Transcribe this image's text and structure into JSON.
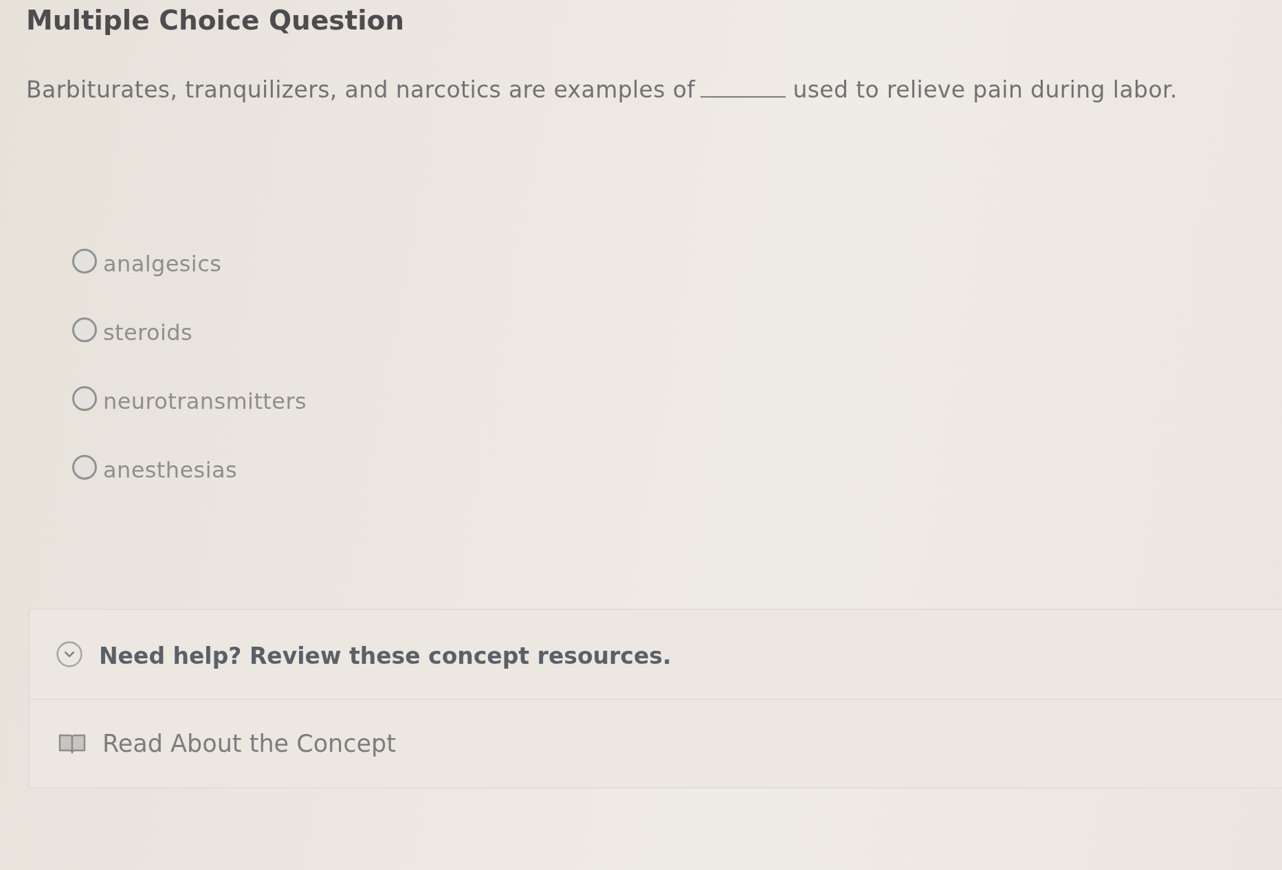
{
  "header": {
    "title": "Multiple Choice Question"
  },
  "question": {
    "before_blank": "Barbiturates, tranquilizers, and narcotics are examples of",
    "after_blank": "used to relieve pain during labor."
  },
  "options": [
    {
      "label": "analgesics",
      "selected": false
    },
    {
      "label": "steroids",
      "selected": false
    },
    {
      "label": "neurotransmitters",
      "selected": false
    },
    {
      "label": "anesthesias",
      "selected": false
    }
  ],
  "help": {
    "heading": "Need help? Review these concept resources.",
    "expanded": true,
    "resources": [
      {
        "kind": "reading",
        "label": "Read About the Concept"
      }
    ]
  }
}
